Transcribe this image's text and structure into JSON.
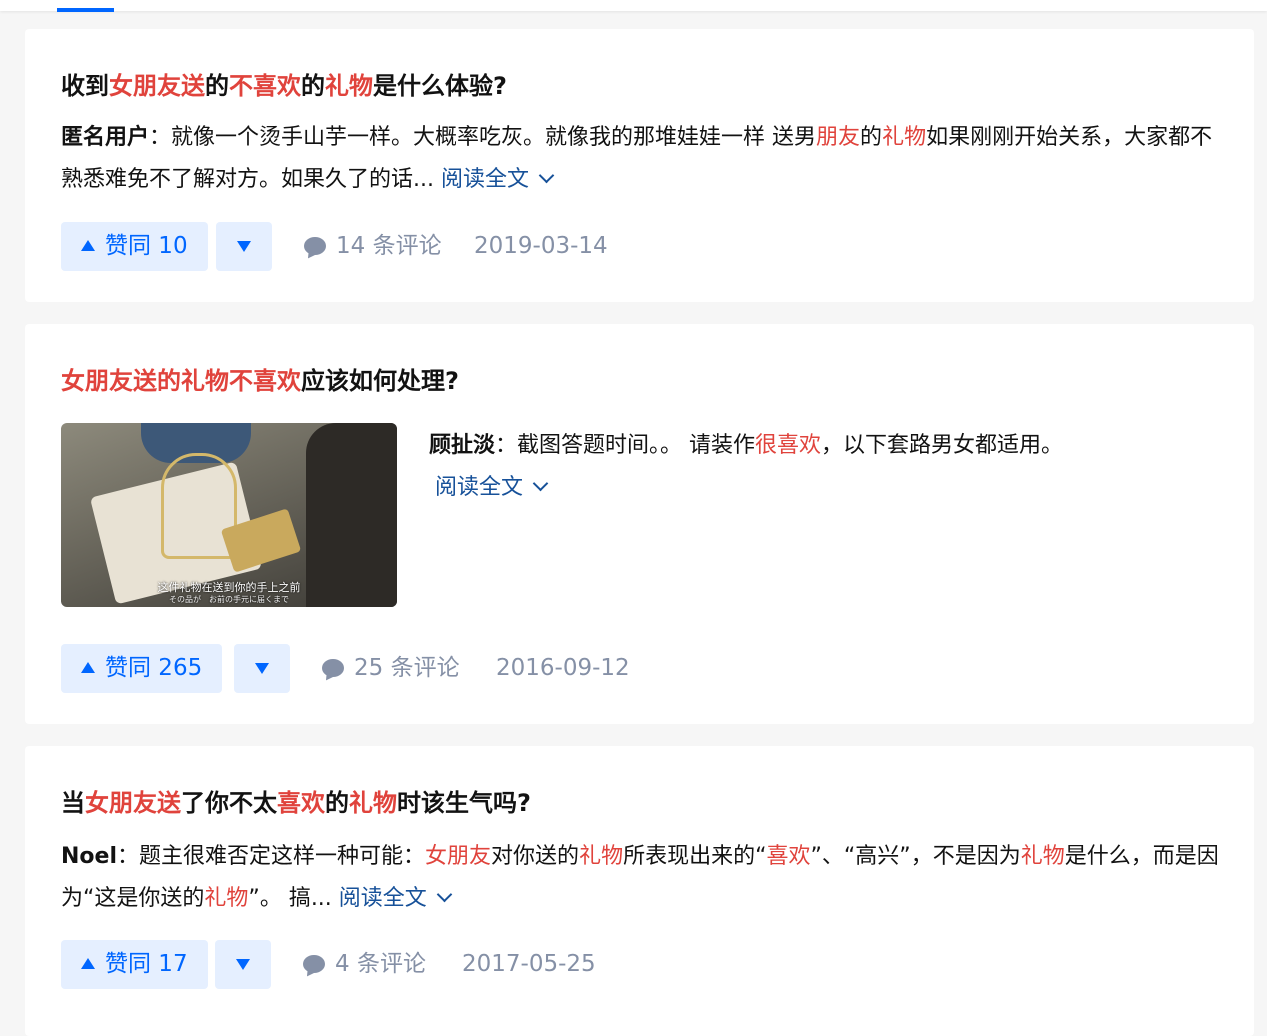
{
  "cards": [
    {
      "title": [
        {
          "text": "收到",
          "hl": false
        },
        {
          "text": "女朋友送",
          "hl": true
        },
        {
          "text": "的",
          "hl": false
        },
        {
          "text": "不喜欢",
          "hl": true
        },
        {
          "text": "的",
          "hl": false
        },
        {
          "text": "礼物",
          "hl": true
        },
        {
          "text": "是什么体验?",
          "hl": false
        }
      ],
      "author": "匿名用户",
      "excerpt": [
        {
          "text": "就像一个烫手山芋一样。大概率吃灰。就像我的那堆娃娃一样 送男",
          "hl": false
        },
        {
          "text": "朋友",
          "hl": true
        },
        {
          "text": "的",
          "hl": false
        },
        {
          "text": "礼物",
          "hl": true
        },
        {
          "text": "如果刚刚开始关系，大家都不熟悉难免不了解对方。如果久了的话... ",
          "hl": false
        }
      ],
      "read_more": "阅读全文",
      "upvote_label": "赞同 10",
      "comments": "14 条评论",
      "date": "2019-03-14"
    },
    {
      "title": [
        {
          "text": "女朋友送的礼物不喜欢",
          "hl": true
        },
        {
          "text": "应该如何处理?",
          "hl": false
        }
      ],
      "author": "顾扯淡",
      "excerpt": [
        {
          "text": "截图答题时间。。 请装作",
          "hl": false
        },
        {
          "text": "很喜欢",
          "hl": true
        },
        {
          "text": "，以下套路男女都适用。",
          "hl": false
        }
      ],
      "thumbnail": {
        "subtitle_cn": "这件礼物在送到你的手上之前",
        "subtitle_jp": "その品が　お前の手元に届くまで"
      },
      "read_more": "阅读全文",
      "upvote_label": "赞同 265",
      "comments": "25 条评论",
      "date": "2016-09-12"
    },
    {
      "title": [
        {
          "text": "当",
          "hl": false
        },
        {
          "text": "女朋友送",
          "hl": true
        },
        {
          "text": "了你不太",
          "hl": false
        },
        {
          "text": "喜欢",
          "hl": true
        },
        {
          "text": "的",
          "hl": false
        },
        {
          "text": "礼物",
          "hl": true
        },
        {
          "text": "时该生气吗?",
          "hl": false
        }
      ],
      "author": "Noel",
      "excerpt": [
        {
          "text": "题主很难否定这样一种可能：",
          "hl": false
        },
        {
          "text": "女朋友",
          "hl": true
        },
        {
          "text": "对你送的",
          "hl": false
        },
        {
          "text": "礼物",
          "hl": true
        },
        {
          "text": "所表现出来的“",
          "hl": false
        },
        {
          "text": "喜欢",
          "hl": true
        },
        {
          "text": "”、“高兴”，不是因为",
          "hl": false
        },
        {
          "text": "礼物",
          "hl": true
        },
        {
          "text": "是什么，而是因为“这是你送的",
          "hl": false
        },
        {
          "text": "礼物",
          "hl": true
        },
        {
          "text": "”。 搞... ",
          "hl": false
        }
      ],
      "read_more": "阅读全文",
      "upvote_label": "赞同 17",
      "comments": "4 条评论",
      "date": "2017-05-25"
    }
  ]
}
